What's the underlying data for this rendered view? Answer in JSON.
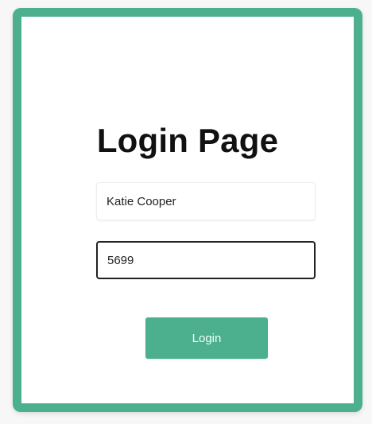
{
  "login_form": {
    "title": "Login Page",
    "username_value": "Katie Cooper",
    "password_value": "5699",
    "button_label": "Login"
  },
  "colors": {
    "accent": "#4caf8d",
    "text": "#111111"
  }
}
